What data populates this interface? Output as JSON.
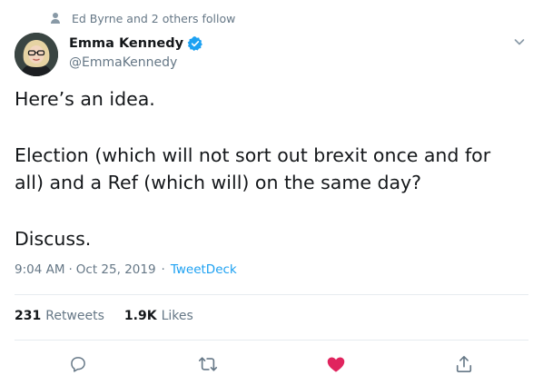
{
  "social_context": {
    "text": "Ed Byrne and 2 others follow",
    "icon": "person-icon"
  },
  "author": {
    "name": "Emma Kennedy",
    "handle": "@EmmaKennedy",
    "verified": true
  },
  "tweet": {
    "paragraphs": [
      "Here’s an idea.",
      "Election (which will not sort out brexit once and for all) and a Ref (which will) on the same day?",
      "Discuss."
    ]
  },
  "meta": {
    "time": "9:04 AM",
    "sep1": "·",
    "date": "Oct 25, 2019",
    "sep2": "·",
    "source": "TweetDeck"
  },
  "stats": {
    "retweets": {
      "count": "231",
      "label": "Retweets"
    },
    "likes": {
      "count": "1.9K",
      "label": "Likes"
    }
  },
  "actions": [
    "reply-icon",
    "retweet-icon",
    "like-icon",
    "share-icon"
  ],
  "colors": {
    "accent": "#1da1f2",
    "like": "#e0245e",
    "muted": "#657786",
    "text": "#14171a",
    "divider": "#e6ecf0"
  }
}
